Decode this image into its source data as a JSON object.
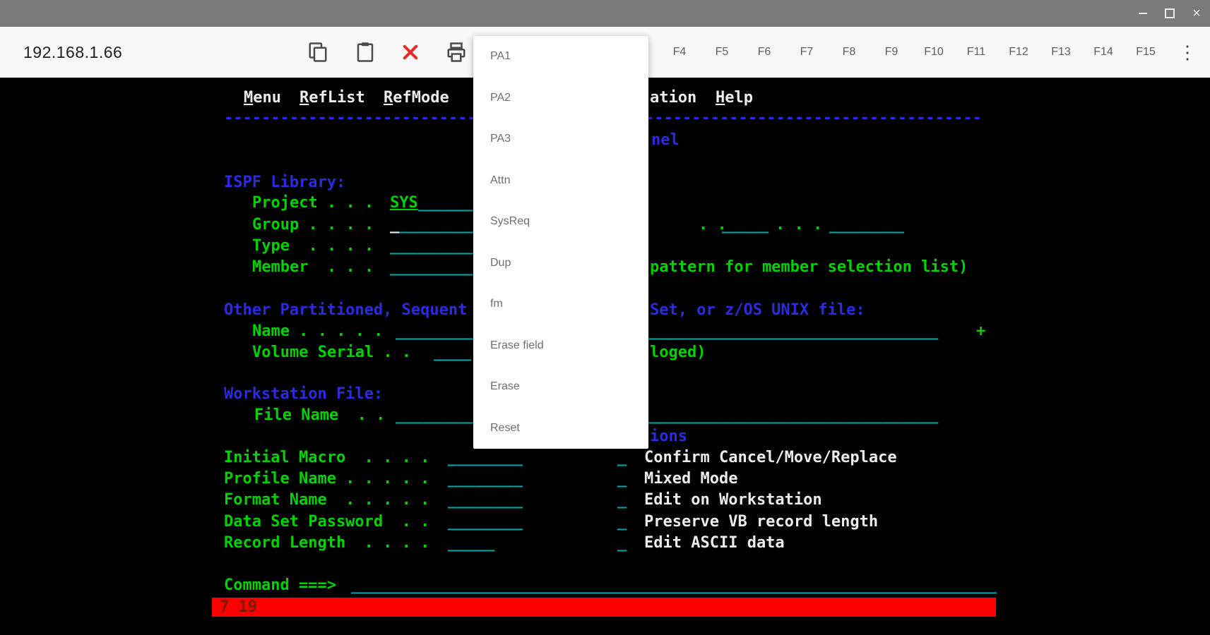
{
  "colors": {
    "titlebar_gray": "#7a7a7a",
    "toolbar_bg": "#f8f8f8",
    "terminal_green": "#00d200",
    "terminal_cyan": "#00a6a6",
    "terminal_blue": "#2b2be0",
    "terminal_white": "#ececec",
    "status_red": "#fb0000",
    "close_icon_red": "#e62b28"
  },
  "window": {
    "titlebar": {
      "icons": [
        "minimize-icon",
        "restore-icon",
        "close-icon"
      ],
      "close_glyph": "×"
    },
    "toolbar": {
      "address": "192.168.1.66",
      "icons": [
        "copy-icon",
        "paste-icon",
        "close-session-icon",
        "print-icon"
      ],
      "function_keys": [
        "F4",
        "F5",
        "F6",
        "F7",
        "F8",
        "F9",
        "F10",
        "F11",
        "F12",
        "F13",
        "F14",
        "F15"
      ],
      "overflow_glyph": "⋮"
    }
  },
  "dropdown": {
    "items": [
      "PA1",
      "PA2",
      "PA3",
      "Attn",
      "SysReq",
      "Dup",
      "fm",
      "Erase field",
      "Erase",
      "Reset"
    ]
  },
  "terminal": {
    "action_bar": {
      "item1": "Menu",
      "item2": "RefList",
      "item3": "RefMode",
      "workstation_fragment": "ation",
      "help": "Help"
    },
    "divider": "---------------------------------------------------------------------------------",
    "panel_title_fragment": "nel",
    "sections": {
      "ispf_library": "ISPF Library:",
      "other_dataset_left": "Other Partitioned, Sequent",
      "other_dataset_right": "Set, or z/OS UNIX file:",
      "workstation_file": "Workstation File:",
      "options_fragment": "ions"
    },
    "fields": {
      "project_label": "Project . . .",
      "project_value": "SYS",
      "project_field": "______",
      "group_label": "Group . . . .",
      "group_field1": "_________",
      "group_sep1": ". .",
      "group_field2": "_____",
      "group_sep2": ". . .",
      "group_field3": "________",
      "type_label": "Type  . . . .",
      "type_field": "_________",
      "member_label": "Member  . . .",
      "member_field": "_________",
      "member_hint_fragment": "pattern for member selection list)",
      "name_label": "Name . . . . .",
      "name_field": "__________________________________________________________",
      "name_more": "+",
      "volume_label": "Volume Serial . .",
      "volume_field": "____",
      "volume_hint_fragment": "loged)",
      "filename_label": "File Name  . .",
      "filename_field": "__________________________________________________________"
    },
    "cursor_char": "_",
    "options_checkbox": "_",
    "options": [
      {
        "label": "Initial Macro  . . . .",
        "field": "________",
        "text": "Confirm Cancel/Move/Replace"
      },
      {
        "label": "Profile Name . . . . .",
        "field": "________",
        "text": "Mixed Mode"
      },
      {
        "label": "Format Name  . . . . .",
        "field": "________",
        "text": "Edit on Workstation"
      },
      {
        "label": "Data Set Password  . .",
        "field": "________",
        "text": "Preserve VB record length"
      },
      {
        "label": "Record Length  . . . .",
        "field": "_____",
        "text": "Edit ASCII data"
      }
    ],
    "command": {
      "label": "Command ===>",
      "field": "_____________________________________________________________________"
    },
    "status": {
      "cursor_position": "7 19"
    }
  }
}
